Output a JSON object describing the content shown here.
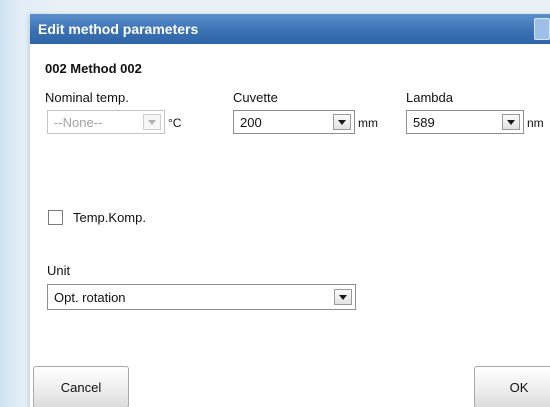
{
  "dialog": {
    "title": "Edit method parameters",
    "method_heading": "002 Method 002"
  },
  "nominal_temp": {
    "label": "Nominal temp.",
    "value": "--None--",
    "unit": "°C",
    "enabled": false
  },
  "cuvette": {
    "label": "Cuvette",
    "value": "200",
    "unit": "mm"
  },
  "lambda": {
    "label": "Lambda",
    "value": "589",
    "unit": "nm"
  },
  "temp_komp": {
    "label": "Temp.Komp.",
    "checked": false
  },
  "unit": {
    "label": "Unit",
    "value": "Opt. rotation"
  },
  "buttons": {
    "cancel": "Cancel",
    "ok": "OK"
  },
  "colors": {
    "titlebar": "#3b72b5",
    "dialog_bg": "#ffffff",
    "desktop_bg": "#dbeaf5"
  },
  "icons": {
    "dropdown": "chevron-down-icon",
    "close": "close-icon"
  }
}
